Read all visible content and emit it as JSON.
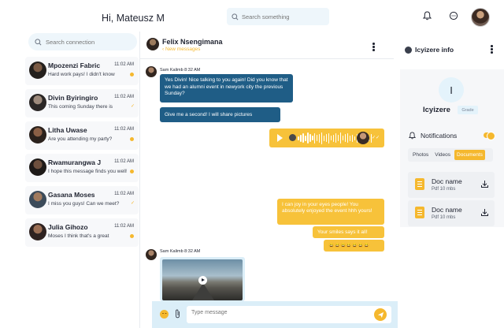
{
  "header": {
    "greeting": "Hi, Mateusz M",
    "search_placeholder": "Search something",
    "icons": [
      "search-icon",
      "bell-icon",
      "chat-icon"
    ]
  },
  "connections": {
    "search_placeholder": "Search connection",
    "items": [
      {
        "name": "Mpozenzi Fabric",
        "time": "11:02 AM",
        "message": "Hard work pays! I didn't know",
        "status": "unread"
      },
      {
        "name": "Divin Byiringiro",
        "time": "11:02 AM",
        "message": "This coming Sunday there is",
        "status": "read"
      },
      {
        "name": "Litha Uwase",
        "time": "11:02 AM",
        "message": "Are you attending my party?",
        "status": "unread"
      },
      {
        "name": "Rwamurangwa J",
        "time": "11:02 AM",
        "message": "I hope this message finds you well!",
        "status": "unread"
      },
      {
        "name": "Gasana Moses",
        "time": "11:02 AM",
        "message": "I miss you guys! Can we meet?",
        "status": "read"
      },
      {
        "name": "Julia Gihozo",
        "time": "11:02 AM",
        "message": "Moses I think that's a great",
        "status": "unread"
      }
    ]
  },
  "chat": {
    "contact_name": "Felix Nsengimana",
    "sub_label": "New messages",
    "sender_1": "Sam Kalimb 8:32 AM",
    "blue_1": "Yes Divin! Nice talking to you again! Did you know that we had an alumni event in newyork city the previous Sunday?",
    "blue_2": "Give me a second! I will share pictures",
    "yellow_1": "I can joy in your eyes people! You absolutely enjoyed the event hhh yours!",
    "yellow_2": "Your smiles says it all!",
    "yellow_3": "😀😀😀😀😀😀😀",
    "sender_2": "Sam Kalimb 8:32 AM",
    "composer_placeholder": "Type message"
  },
  "info": {
    "title": "Icyizere info",
    "avatar_letter": "I",
    "name": "Icyizere",
    "grade": "Grade",
    "notifications_label": "Notifications",
    "notifications_on": true,
    "tabs": [
      "Photos",
      "Videos",
      "Documents"
    ],
    "active_tab": "Documents",
    "docs": [
      {
        "name": "Doc name",
        "meta": "Pdf  10 mbs"
      },
      {
        "name": "Doc name",
        "meta": "Pdf  10 mbs"
      }
    ]
  },
  "colors": {
    "accent": "#f5b82e",
    "bubble_blue": "#1f5d86",
    "panel_bg": "#eef6fb"
  }
}
